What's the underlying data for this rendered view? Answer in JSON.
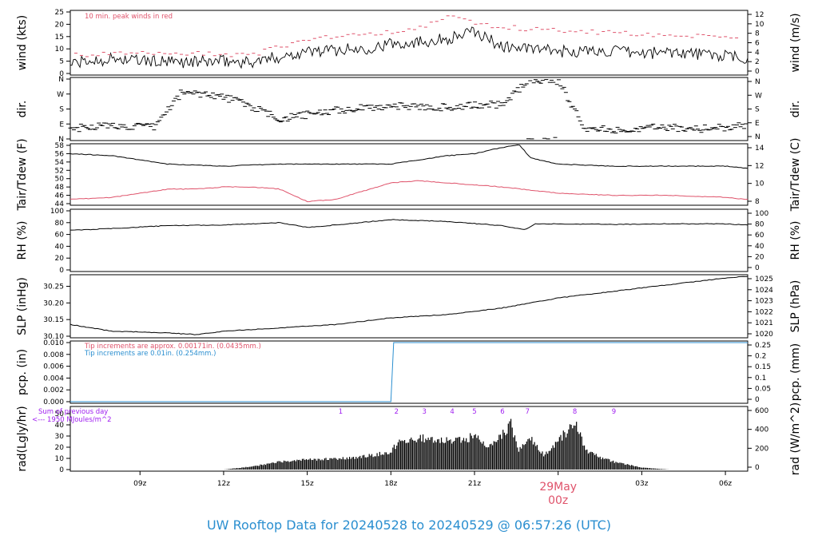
{
  "title": "UW Rooftop Data for 20240528  to  20240529 @ 06:57:26  (UTC)",
  "colors": {
    "title": "#2b8fd0",
    "red": "#df536b",
    "blue": "#2b8fd0",
    "purple": "#a020f0",
    "black": "#000000"
  },
  "date_label": {
    "day": "29May",
    "hour": "00z"
  },
  "chart_data": [
    {
      "id": "wind",
      "type": "line",
      "ylabel_left": "wind (kts)",
      "ylabel_right": "wind (m/s)",
      "yticks_left": [
        "25",
        "20",
        "15",
        "10",
        "5",
        "0"
      ],
      "yticks_right": [
        "12",
        "10",
        "8",
        "6",
        "4",
        "2",
        "0"
      ],
      "ylim": [
        0,
        25
      ],
      "annotation": "10 min. peak winds in red",
      "series": [
        {
          "style": "black-line",
          "x": [
            6.5,
            8,
            10,
            12,
            13,
            15,
            17,
            18,
            19,
            20,
            21,
            22,
            23,
            24,
            25,
            26,
            27,
            28,
            29,
            30,
            30.8
          ],
          "y": [
            4,
            6,
            4.5,
            5,
            4.5,
            9,
            10,
            12,
            13,
            14,
            17,
            11,
            10,
            9,
            9,
            9,
            8,
            9,
            8,
            7,
            6
          ]
        },
        {
          "style": "red-peaks",
          "x": [
            7,
            9,
            11,
            13,
            15,
            17,
            19,
            20.2,
            21,
            23,
            25,
            27,
            29,
            30.5
          ],
          "y": [
            7.5,
            8,
            8,
            7.5,
            14,
            16,
            18,
            24,
            20,
            18,
            17,
            16,
            15,
            14
          ]
        }
      ]
    },
    {
      "id": "dir",
      "type": "scatter",
      "ylabel_left": "dir.",
      "ylabel_right": "dir.",
      "yticks_left": [
        "N",
        "W",
        "S",
        "E",
        "N"
      ],
      "yticks_right": [
        "N",
        "W",
        "S",
        "E",
        "N"
      ],
      "ylim": [
        0,
        360
      ],
      "series": [
        {
          "style": "black-dash",
          "x": [
            6.5,
            7.5,
            8.5,
            9.5,
            10.5,
            11.5,
            12.5,
            14,
            16,
            18,
            19,
            20,
            21,
            22,
            23,
            24,
            25,
            26,
            27,
            28,
            29,
            30,
            30.8
          ],
          "y": [
            60,
            80,
            75,
            70,
            280,
            270,
            230,
            120,
            170,
            200,
            195,
            190,
            200,
            210,
            355,
            350,
            60,
            55,
            65,
            70,
            60,
            70,
            80
          ]
        }
      ]
    },
    {
      "id": "temp",
      "type": "line",
      "ylabel_left": "Tair/Tdew (F)",
      "ylabel_right": "Tair/Tdew (C)",
      "yticks_left": [
        "58",
        "56",
        "54",
        "52",
        "50",
        "48",
        "46",
        "44"
      ],
      "yticks_right": [
        "14",
        "12",
        "10",
        "8"
      ],
      "ylim": [
        44,
        58
      ],
      "series": [
        {
          "name": "Tair",
          "color": "black",
          "x": [
            6.5,
            8,
            10,
            12,
            14,
            16,
            18,
            20,
            21,
            22,
            22.6,
            23,
            24,
            26,
            28,
            30,
            30.8
          ],
          "y": [
            56,
            55.5,
            53.5,
            53,
            53.5,
            53.5,
            53.5,
            55.5,
            56,
            57.5,
            58.2,
            55,
            53.5,
            53,
            53,
            53,
            52.5
          ]
        },
        {
          "name": "Tdew",
          "color": "red",
          "x": [
            6.5,
            8,
            10,
            11,
            12,
            13,
            14,
            15,
            16,
            18,
            19,
            20,
            22,
            24,
            26,
            28,
            30,
            30.8
          ],
          "y": [
            45,
            45.5,
            47.5,
            47.5,
            48,
            48,
            47.5,
            44.5,
            45,
            49,
            49.5,
            49,
            48,
            46.5,
            46,
            46,
            45.5,
            45
          ]
        }
      ]
    },
    {
      "id": "rh",
      "type": "line",
      "ylabel_left": "RH (%)",
      "ylabel_right": "RH (%)",
      "yticks_left": [
        "100",
        "80",
        "60",
        "40",
        "20",
        "0"
      ],
      "yticks_right": [
        "100",
        "80",
        "60",
        "40",
        "20",
        "0"
      ],
      "ylim": [
        0,
        100
      ],
      "series": [
        {
          "color": "black",
          "x": [
            6.5,
            8,
            10,
            12,
            13,
            14,
            15,
            16,
            18,
            20,
            22,
            22.8,
            23.2,
            24,
            26,
            28,
            30,
            30.8
          ],
          "y": [
            67,
            70,
            75,
            76,
            78,
            80,
            72,
            76,
            85,
            82,
            75,
            68,
            78,
            78,
            77,
            78,
            78,
            76
          ]
        }
      ]
    },
    {
      "id": "slp",
      "type": "line",
      "ylabel_left": "SLP (inHg)",
      "ylabel_right": "SLP (hPa)",
      "yticks_left": [
        "30.25",
        "30.20",
        "30.15",
        "30.10"
      ],
      "yticks_right": [
        "1025",
        "1024",
        "1023",
        "1022",
        "1021",
        "1020"
      ],
      "ylim": [
        30.1,
        30.28
      ],
      "series": [
        {
          "color": "black",
          "x": [
            6.5,
            8,
            10,
            11,
            12,
            14,
            16,
            18,
            20,
            22,
            24,
            26,
            28,
            30,
            30.8
          ],
          "y": [
            30.135,
            30.115,
            30.11,
            30.105,
            30.115,
            30.125,
            30.135,
            30.155,
            30.165,
            30.185,
            30.215,
            30.235,
            30.255,
            30.275,
            30.28
          ]
        }
      ]
    },
    {
      "id": "pcp",
      "type": "line",
      "ylabel_left": "pcp. (in)",
      "ylabel_right": "pcp. (mm)",
      "yticks_left": [
        "0.010",
        "0.008",
        "0.006",
        "0.004",
        "0.002",
        "0.000"
      ],
      "yticks_right": [
        "0.25",
        "0.2",
        "0.15",
        "0.1",
        "0.05",
        "0"
      ],
      "ylim": [
        0,
        0.01
      ],
      "annotations": [
        {
          "text": "Tip increments are approx. 0.00171in. (0.0435mm.)",
          "color": "red"
        },
        {
          "text": "Tip increments are 0.01in. (0.254mm.)",
          "color": "blue"
        }
      ],
      "series": [
        {
          "color": "blue",
          "x": [
            6.5,
            18.0,
            18.1,
            30.8
          ],
          "y": [
            0,
            0,
            0.01,
            0.01
          ]
        }
      ]
    },
    {
      "id": "rad",
      "type": "area",
      "ylabel_left": "rad(Lgly/hr)",
      "ylabel_right": "rad (W/m^2)",
      "yticks_left": [
        "50",
        "40",
        "30",
        "20",
        "10",
        "0"
      ],
      "yticks_right": [
        "600",
        "400",
        "200",
        "0"
      ],
      "ylim": [
        0,
        55
      ],
      "annotations": [
        {
          "text": "Sum of previous day",
          "color": "purple"
        },
        {
          "text": "<--- 1950 MJoules/m^2",
          "color": "purple"
        }
      ],
      "hour_markers": [
        {
          "label": "1",
          "x": 16.2
        },
        {
          "label": "2",
          "x": 18.2
        },
        {
          "label": "3",
          "x": 19.2
        },
        {
          "label": "4",
          "x": 20.2
        },
        {
          "label": "5",
          "x": 21.0
        },
        {
          "label": "6",
          "x": 22.0
        },
        {
          "label": "7",
          "x": 22.9
        },
        {
          "label": "8",
          "x": 24.6
        },
        {
          "label": "9",
          "x": 26.0
        }
      ],
      "series": [
        {
          "color": "black",
          "x": [
            12,
            13,
            14,
            15,
            16,
            17,
            18,
            18.3,
            19,
            20,
            21,
            21.5,
            22,
            22.3,
            22.6,
            23,
            23.5,
            24,
            24.6,
            25,
            25.5,
            26,
            27,
            28
          ],
          "y": [
            0,
            3,
            8,
            10,
            11,
            13,
            18,
            30,
            32,
            30,
            33,
            25,
            35,
            46,
            20,
            32,
            15,
            28,
            50,
            20,
            12,
            8,
            2,
            0
          ]
        }
      ]
    }
  ],
  "x_axis": {
    "ticks": [
      "09z",
      "12z",
      "15z",
      "18z",
      "21z",
      "03z",
      "06z"
    ],
    "tick_values": [
      9,
      12,
      15,
      18,
      21,
      27,
      30
    ]
  }
}
